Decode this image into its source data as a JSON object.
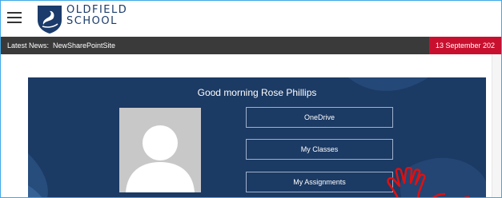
{
  "header": {
    "school_name_line1": "OLDFIELD",
    "school_name_line2": "SCHOOL",
    "menu_icon": "hamburger-icon",
    "logo_icon": "swan-crest-icon"
  },
  "newsbar": {
    "label": "Latest News:",
    "item": "NewSharePointSite",
    "date": "13 September 202"
  },
  "hero": {
    "greeting": "Good morning Rose Phillips",
    "buttons": [
      "OneDrive",
      "My Classes",
      "My Assignments"
    ]
  },
  "colors": {
    "header_bg": "#ffffff",
    "newsbar_bg": "#3a3a3a",
    "date_bg": "#c8102e",
    "hero_bg": "#1b3a64",
    "annotation": "#e01010"
  }
}
